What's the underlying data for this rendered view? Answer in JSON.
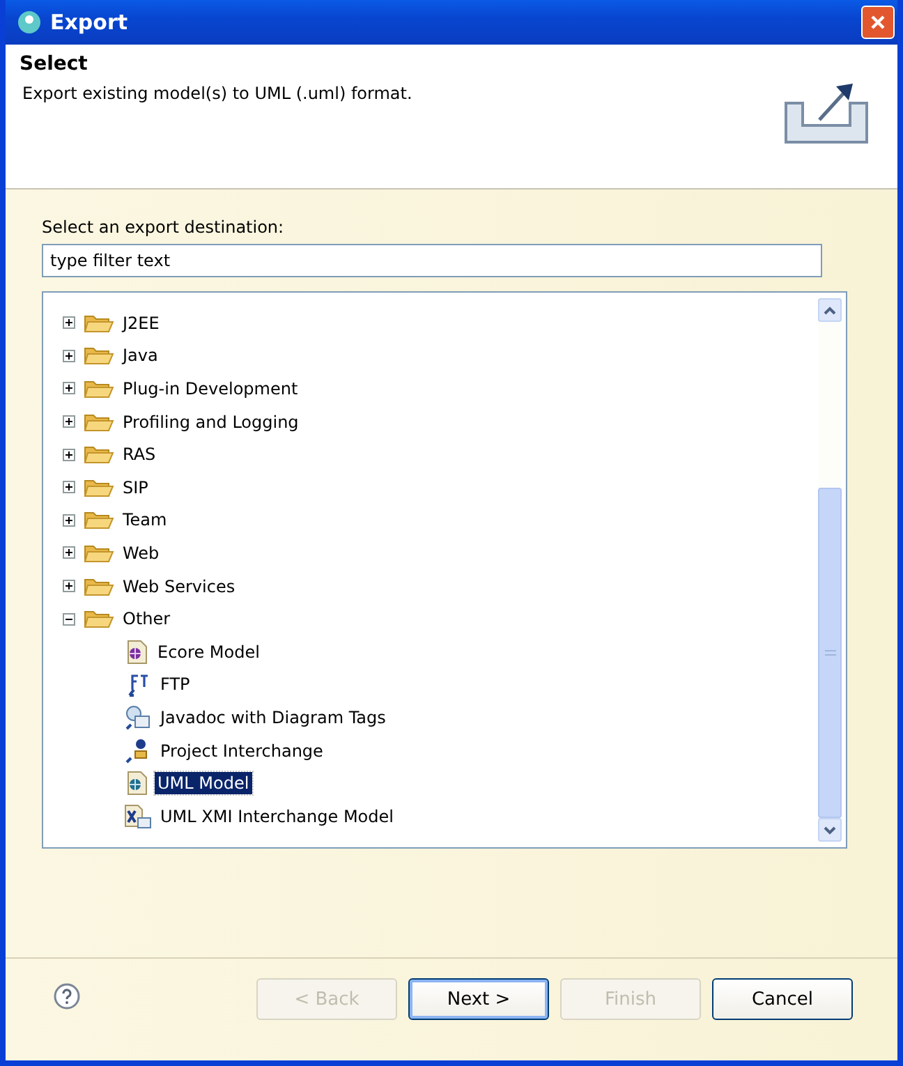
{
  "window": {
    "title": "Export"
  },
  "header": {
    "title": "Select",
    "description": "Export existing model(s) to UML (.uml) format."
  },
  "destination_label": "Select an export destination:",
  "filter": {
    "placeholder": "type filter text"
  },
  "tree": [
    {
      "label": "J2EE",
      "kind": "folder",
      "expanded": false,
      "selected": false
    },
    {
      "label": "Java",
      "kind": "folder",
      "expanded": false,
      "selected": false
    },
    {
      "label": "Plug-in Development",
      "kind": "folder",
      "expanded": false,
      "selected": false
    },
    {
      "label": "Profiling and Logging",
      "kind": "folder",
      "expanded": false,
      "selected": false
    },
    {
      "label": "RAS",
      "kind": "folder",
      "expanded": false,
      "selected": false
    },
    {
      "label": "SIP",
      "kind": "folder",
      "expanded": false,
      "selected": false
    },
    {
      "label": "Team",
      "kind": "folder",
      "expanded": false,
      "selected": false
    },
    {
      "label": "Web",
      "kind": "folder",
      "expanded": false,
      "selected": false
    },
    {
      "label": "Web Services",
      "kind": "folder",
      "expanded": false,
      "selected": false
    },
    {
      "label": "Other",
      "kind": "folder",
      "expanded": true,
      "selected": false,
      "children": [
        {
          "label": "Ecore Model",
          "kind": "ecore",
          "selected": false
        },
        {
          "label": "FTP",
          "kind": "ftp",
          "selected": false
        },
        {
          "label": "Javadoc with Diagram Tags",
          "kind": "javadoc",
          "selected": false
        },
        {
          "label": "Project Interchange",
          "kind": "project",
          "selected": false
        },
        {
          "label": "UML Model",
          "kind": "uml",
          "selected": true
        },
        {
          "label": "UML XMI Interchange Model",
          "kind": "xmi",
          "selected": false
        }
      ]
    }
  ],
  "buttons": [
    {
      "label": "< Back",
      "disabled": true,
      "default": false
    },
    {
      "label": "Next >",
      "disabled": false,
      "default": true
    },
    {
      "label": "Finish",
      "disabled": true,
      "default": false
    },
    {
      "label": "Cancel",
      "disabled": false,
      "default": false
    }
  ]
}
